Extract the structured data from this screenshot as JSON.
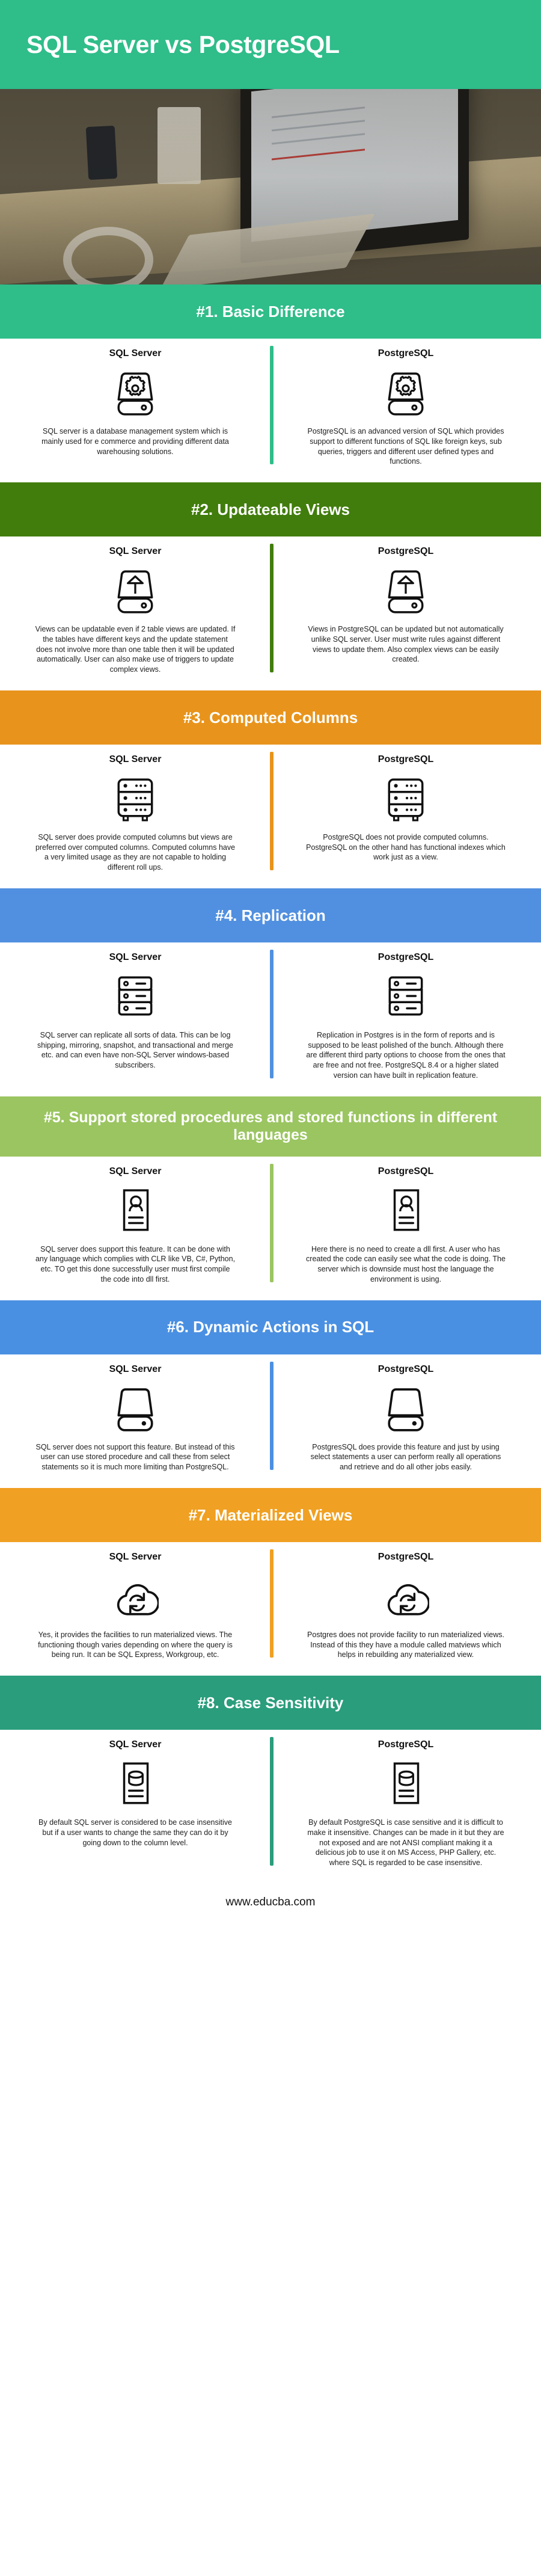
{
  "header": {
    "title": "SQL Server vs PostgreSQL",
    "banner_color": "#2fbd8a"
  },
  "hero": {
    "alt": "desk with imac monitor keyboard headphones and phone"
  },
  "labels": {
    "left": "SQL Server",
    "right": "PostgreSQL"
  },
  "sections": [
    {
      "number": "#1.",
      "title": "#1. Basic Difference",
      "color": "#2fbd8a",
      "icon": "database-gear-icon",
      "left": {
        "heading": "SQL Server",
        "text": "SQL server is a database management system which is mainly used for e commerce and providing different data warehousing solutions."
      },
      "right": {
        "heading": "PostgreSQL",
        "text": "PostgreSQL is an advanced version of SQL which provides support to different functions of SQL like foreign keys, sub queries, triggers and different user defined types and functions."
      }
    },
    {
      "number": "#2.",
      "title": "#2. Updateable Views",
      "color": "#417d0c",
      "icon": "database-upload-icon",
      "left": {
        "heading": "SQL Server",
        "text": "Views can be updatable even if 2 table views are updated. If the tables have different keys and the update statement does not involve more than one table then it will be updated automatically. User can also make use of triggers to update complex views."
      },
      "right": {
        "heading": "PostgreSQL",
        "text": "Views in PostgreSQL can be updated but not automatically unlike SQL server. User must write rules against different views to update them. Also complex views can be easily created."
      }
    },
    {
      "number": "#3.",
      "title": "#3. Computed Columns",
      "color": "#e8941c",
      "icon": "server-rack-icon",
      "left": {
        "heading": "SQL Server",
        "text": "SQL server does provide computed columns but views are preferred over computed columns. Computed columns have a very limited usage as they are not capable to holding different roll ups."
      },
      "right": {
        "heading": "PostgreSQL",
        "text": "PostgreSQL does not provide computed columns. PostgreSQL on the other hand has functional indexes which work just as a view."
      }
    },
    {
      "number": "#4.",
      "title": "#4. Replication",
      "color": "#5190e0",
      "icon": "server-stack-icon",
      "left": {
        "heading": "SQL Server",
        "text": "SQL server can replicate all sorts of data. This can be log shipping, mirroring, snapshot, and transactional and merge etc. and can even have non-SQL Server windows-based subscribers."
      },
      "right": {
        "heading": "PostgreSQL",
        "text": "Replication in Postgres is in the form of reports and is supposed to be least polished of the bunch. Although there are different third party options to choose from the ones that are free and not free. PostgreSQL 8.4 or a higher slated version can have built in replication feature."
      }
    },
    {
      "number": "#5.",
      "title": "#5. Support stored procedures and stored functions in different languages",
      "color": "#9bc561",
      "icon": "document-user-icon",
      "two_line": true,
      "left": {
        "heading": "SQL Server",
        "text": "SQL server does support this feature. It can be done with any language which complies with CLR like VB, C#, Python, etc. TO get this done successfully user must first compile the code into dll first."
      },
      "right": {
        "heading": "PostgreSQL",
        "text": "Here there is no need to create a dll first. A user who has created the code can easily see what the code is doing. The server which is downside must host the language the environment is using."
      }
    },
    {
      "number": "#6.",
      "title": "#6. Dynamic Actions in SQL",
      "color": "#4a90e2",
      "icon": "database-plain-icon",
      "left": {
        "heading": "SQL Server",
        "text": "SQL server does not support this feature. But instead of this user can use stored procedure and call these from select statements so it is much more limiting than PostgreSQL."
      },
      "right": {
        "heading": "PostgreSQL",
        "text": "PostgresSQL does provide this feature and just by using select statements a user can perform really all operations and retrieve and do all other jobs easily."
      }
    },
    {
      "number": "#7.",
      "title": "#7. Materialized Views",
      "color": "#f0a022",
      "icon": "cloud-sync-icon",
      "left": {
        "heading": "SQL Server",
        "text": "Yes, it provides the facilities to run materialized views. The functioning though varies depending on where the query is being run. It can be SQL Express, Workgroup, etc."
      },
      "right": {
        "heading": "PostgreSQL",
        "text": "Postgres does not provide facility to run materialized views. Instead of this they have a module called matviews which helps in rebuilding any materialized view."
      }
    },
    {
      "number": "#8.",
      "title": "#8. Case Sensitivity",
      "color": "#2a9d7c",
      "icon": "document-database-icon",
      "left": {
        "heading": "SQL Server",
        "text": "By default SQL server is considered to be case insensitive but if a user wants to change the same they can do it by going down to the column level."
      },
      "right": {
        "heading": "PostgreSQL",
        "text": "By default PostgreSQL is case sensitive and it is difficult to make it insensitive. Changes can be made in it but they are not exposed and are not ANSI compliant making it a delicious job to use it on MS Access, PHP Gallery, etc. where SQL is regarded to be case insensitive."
      }
    }
  ],
  "footer": {
    "url": "www.educba.com"
  }
}
